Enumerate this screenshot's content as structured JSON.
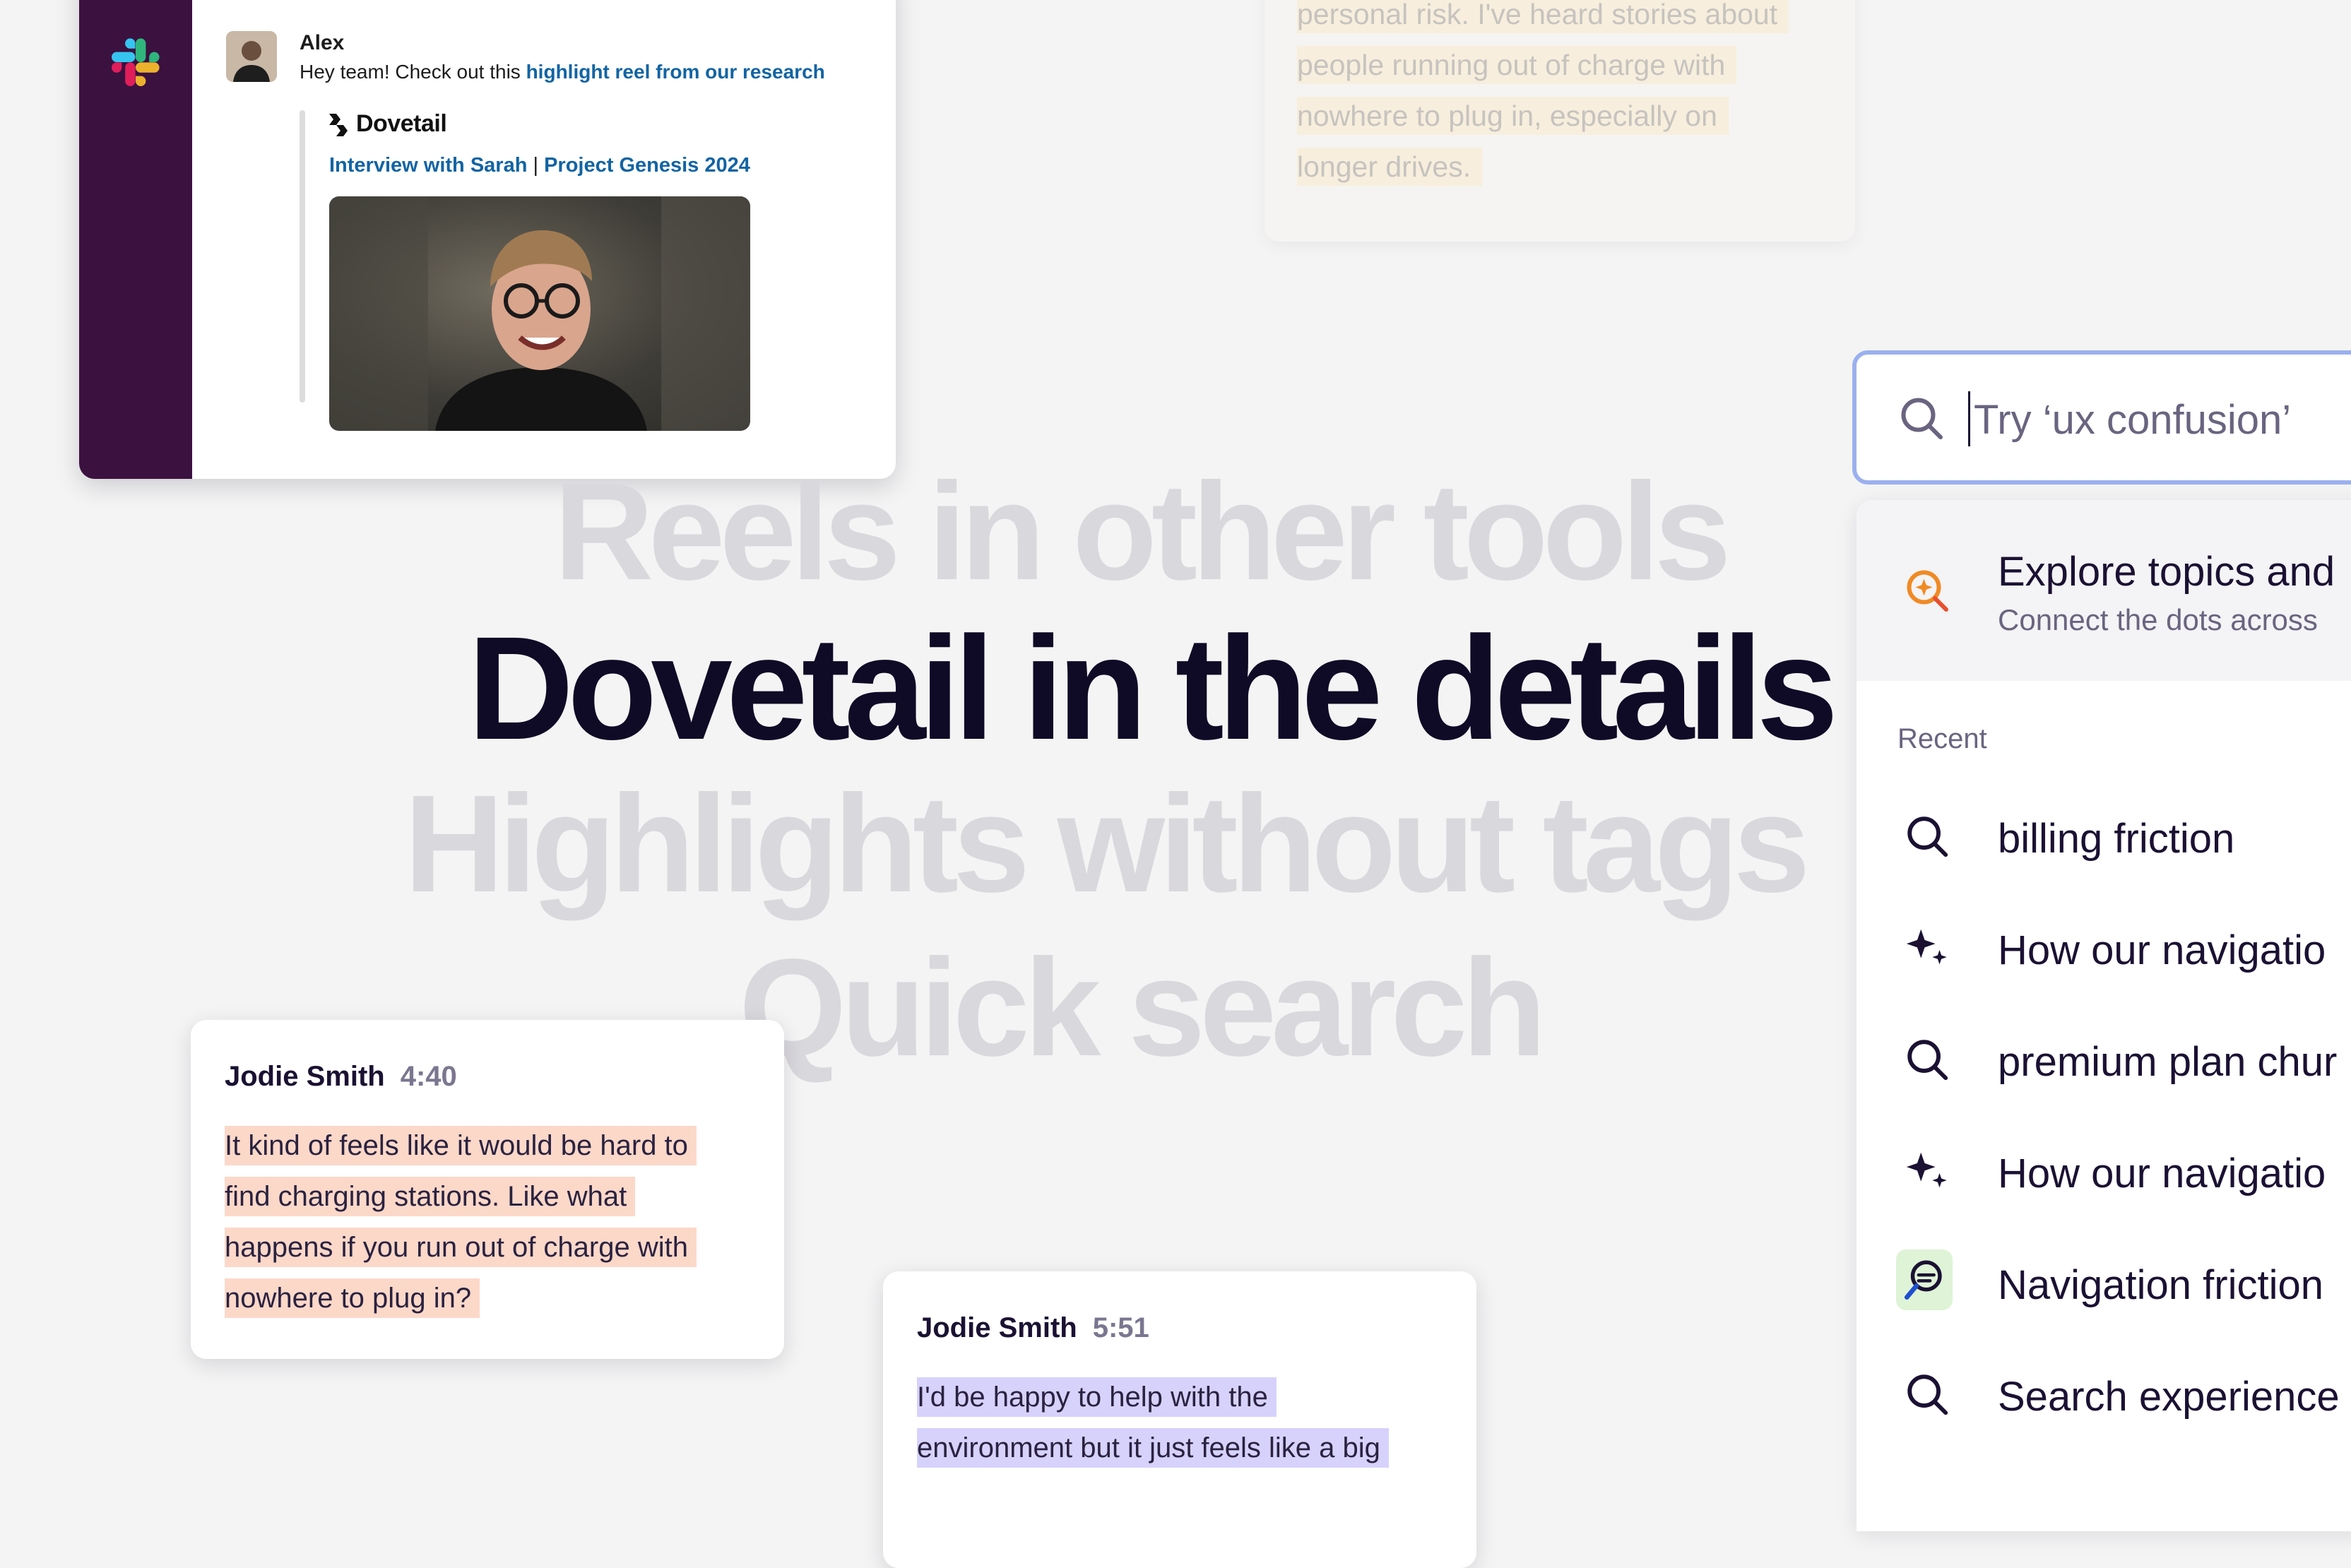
{
  "slack": {
    "author": "Alex",
    "message_prefix": "Hey team! Check out this ",
    "message_link": "highlight reel from our research",
    "brand": "Dovetail",
    "embed_link_1": "Interview with Sarah",
    "embed_separator": " | ",
    "embed_link_2": "Project Genesis 2024"
  },
  "top_quote": {
    "lines": [
      "personal risk. I've heard stories about",
      "people running out of charge with",
      "nowhere to plug in, especially on",
      "longer drives."
    ]
  },
  "headlines": {
    "line1": "Reels in other tools",
    "line2": "Dovetail in the details",
    "line3": "Highlights without tags",
    "line4": "Quick search"
  },
  "card1": {
    "name": "Jodie Smith",
    "time": "4:40",
    "lines": [
      "It kind of feels like it would be hard to",
      "find charging stations. Like what",
      "happens if you run out of charge with",
      "nowhere to plug in?"
    ]
  },
  "card2": {
    "name": "Jodie Smith",
    "time": "5:51",
    "lines": [
      "I'd be happy to help with the",
      "environment but it just feels like a big"
    ]
  },
  "search": {
    "placeholder": "Try ‘ux confusion’",
    "explore_title": "Explore topics and",
    "explore_subtitle": "Connect the dots across",
    "recent_label": "Recent",
    "recent": [
      {
        "icon": "search-icon",
        "text": "billing friction"
      },
      {
        "icon": "sparkle-icon",
        "text": "How our navigatio"
      },
      {
        "icon": "search-icon",
        "text": "premium plan chur"
      },
      {
        "icon": "sparkle-icon",
        "text": "How our navigatio"
      },
      {
        "icon": "topic-icon",
        "text": "Navigation friction"
      },
      {
        "icon": "search-icon",
        "text": "Search experience"
      }
    ]
  },
  "colors": {
    "slack_sidebar": "#3b1140",
    "link_blue": "#1264a3",
    "highlight_peach": "#fcd8c9",
    "highlight_lavender": "#d7d2fb",
    "headline_dark": "#0f0a26",
    "headline_faded": "#d9d8dc",
    "search_border": "#9bb0ef"
  }
}
